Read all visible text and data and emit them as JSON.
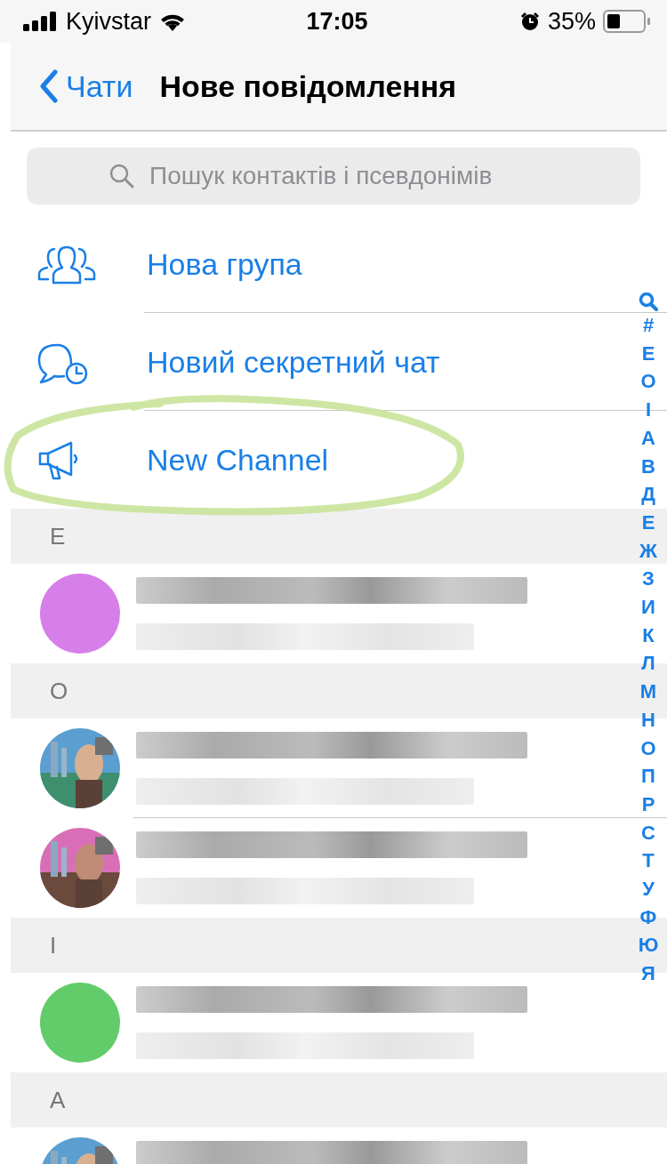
{
  "status_bar": {
    "carrier": "Kyivstar",
    "time": "17:05",
    "battery": "35%"
  },
  "nav": {
    "back": "Чати",
    "title": "Нове повідомлення"
  },
  "search": {
    "placeholder": "Пошук контактів і псевдонімів"
  },
  "actions": [
    {
      "kind": "group",
      "label": "Нова група",
      "highlighted": false
    },
    {
      "kind": "secret",
      "label": "Новий секретний чат",
      "highlighted": false
    },
    {
      "kind": "channel",
      "label": "New Channel",
      "highlighted": true
    }
  ],
  "sections": [
    {
      "letter": "E",
      "contacts": [
        {
          "avatar": {
            "kind": "initial",
            "color": "#d77fe9"
          }
        }
      ]
    },
    {
      "letter": "O"
    },
    {
      "letter": "I",
      "contacts": [
        {
          "avatar": {
            "kind": "initial",
            "color": "#62cc6a"
          }
        }
      ]
    },
    {
      "letter": "A"
    }
  ],
  "index": [
    "#",
    "E",
    "O",
    "І",
    "А",
    "В",
    "Д",
    "Е",
    "Ж",
    "З",
    "И",
    "К",
    "Л",
    "М",
    "Н",
    "О",
    "П",
    "Р",
    "С",
    "Т",
    "У",
    "Ф",
    "Ю",
    "Я"
  ]
}
